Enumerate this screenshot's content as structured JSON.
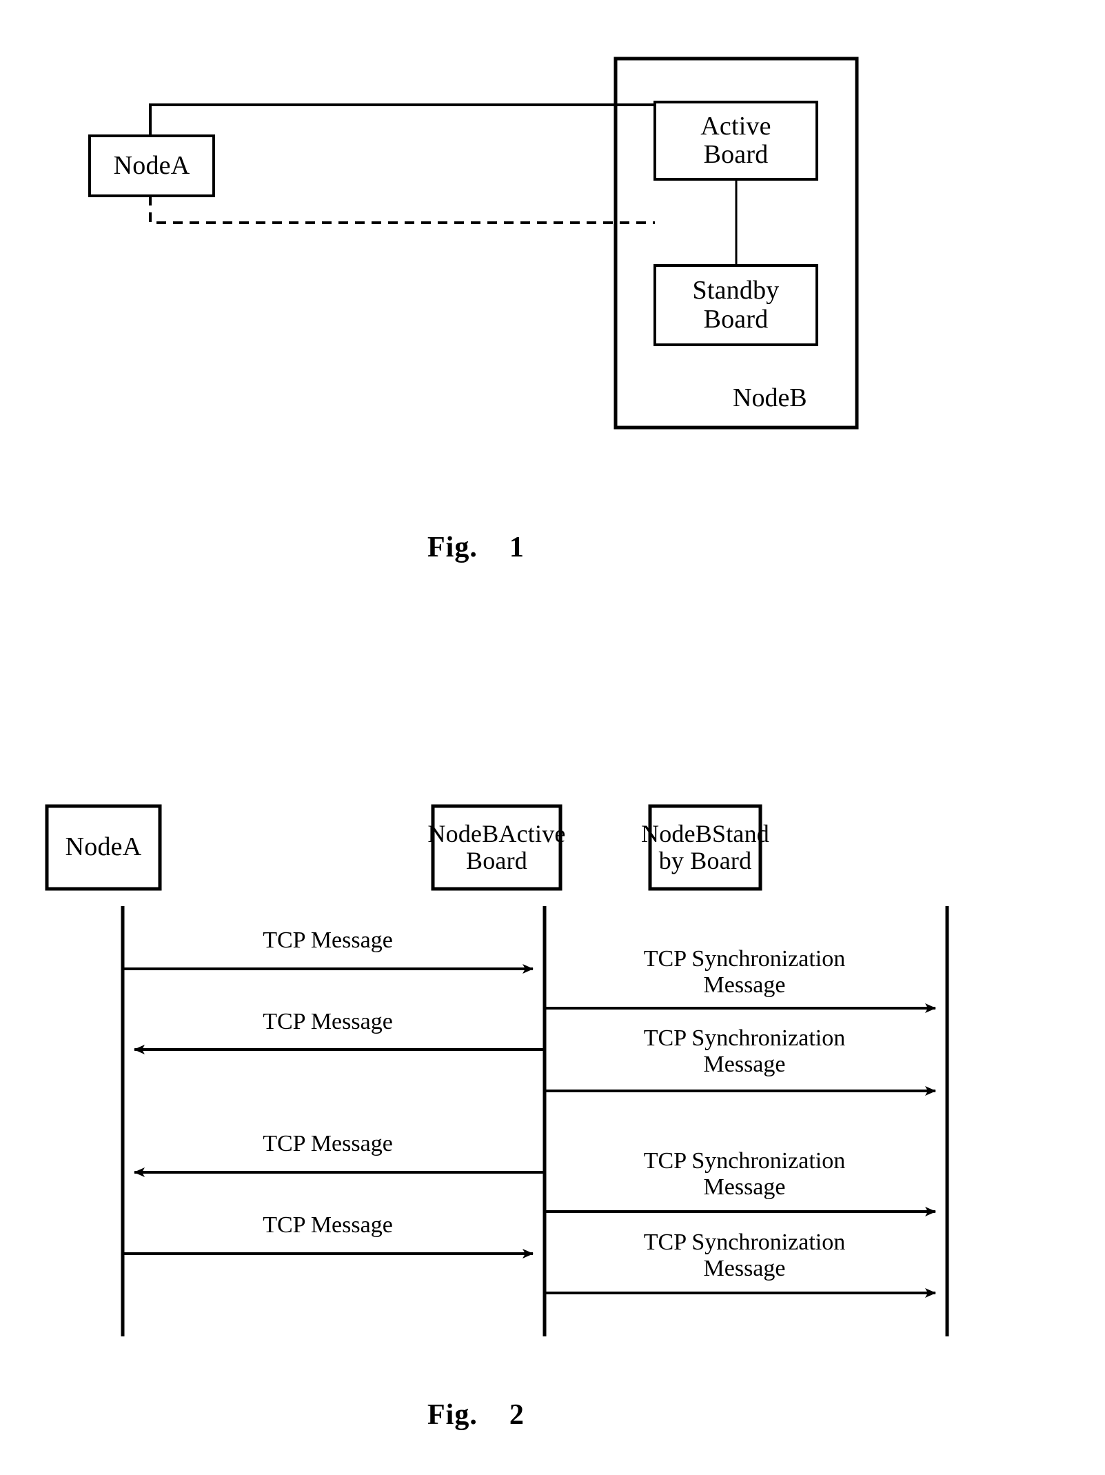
{
  "figure1": {
    "caption": "Fig.    1",
    "nodeA": {
      "label": "NodeA"
    },
    "nodeB": {
      "label": "NodeB"
    },
    "activeBoard": {
      "label": "Active\nBoard"
    },
    "standbyBoard": {
      "label": "Standby\nBoard"
    },
    "connections": [
      {
        "name": "nodeA-to-active-board",
        "style": "solid"
      },
      {
        "name": "nodeA-to-standby-board",
        "style": "dashed"
      },
      {
        "name": "active-board-to-standby-board",
        "style": "solid"
      }
    ]
  },
  "figure2": {
    "caption": "Fig.    2",
    "lifelines": [
      {
        "label": "NodeA"
      },
      {
        "label": "NodeBActive\nBoard"
      },
      {
        "label": "NodeBStand\nby Board"
      }
    ],
    "messages": [
      {
        "label": "TCP Message",
        "from": "NodeA",
        "to": "NodeBActiveBoard",
        "direction": "right"
      },
      {
        "label": "TCP Synchronization\nMessage",
        "from": "NodeBActiveBoard",
        "to": "NodeBStandbyBoard",
        "direction": "right"
      },
      {
        "label": "TCP Message",
        "from": "NodeBActiveBoard",
        "to": "NodeA",
        "direction": "left"
      },
      {
        "label": "TCP Synchronization\nMessage",
        "from": "NodeBActiveBoard",
        "to": "NodeBStandbyBoard",
        "direction": "right"
      },
      {
        "label": "TCP Message",
        "from": "NodeBActiveBoard",
        "to": "NodeA",
        "direction": "left"
      },
      {
        "label": "TCP Synchronization\nMessage",
        "from": "NodeBActiveBoard",
        "to": "NodeBStandbyBoard",
        "direction": "right"
      },
      {
        "label": "TCP Message",
        "from": "NodeA",
        "to": "NodeBActiveBoard",
        "direction": "right"
      },
      {
        "label": "TCP Synchronization\nMessage",
        "from": "NodeBActiveBoard",
        "to": "NodeBStandbyBoard",
        "direction": "right"
      }
    ]
  },
  "colors": {
    "ink": "#000000",
    "paper": "#ffffff"
  }
}
